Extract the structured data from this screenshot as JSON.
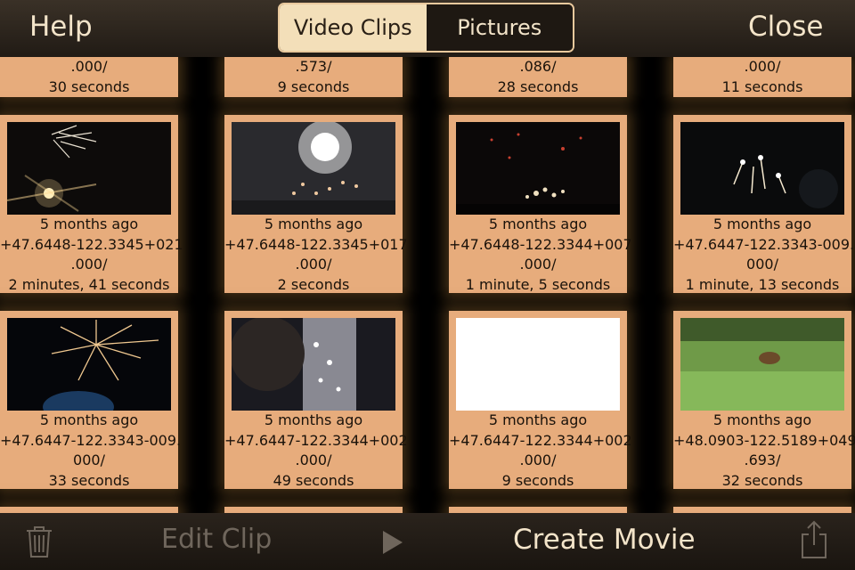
{
  "topbar": {
    "help_label": "Help",
    "close_label": "Close",
    "tabs": [
      "Video Clips",
      "Pictures"
    ],
    "selected_tab": "Video Clips"
  },
  "top_row": [
    {
      "line1": ".000/",
      "line2": "30 seconds"
    },
    {
      "line1": ".573/",
      "line2": "9 seconds"
    },
    {
      "line1": ".086/",
      "line2": "28 seconds"
    },
    {
      "line1": ".000/",
      "line2": "11 seconds"
    }
  ],
  "clips": [
    {
      "date": "5 months ago",
      "location": "+47.6448-122.3345+021",
      "location2": ".000/",
      "duration": "2 minutes, 41 seconds",
      "thumb": "fireworks-moon"
    },
    {
      "date": "5 months ago",
      "location": "+47.6448-122.3345+017",
      "location2": ".000/",
      "duration": "2 seconds",
      "thumb": "fireworks-bright"
    },
    {
      "date": "5 months ago",
      "location": "+47.6448-122.3344+007",
      "location2": ".000/",
      "duration": "1 minute, 5 seconds",
      "thumb": "fireworks-sparkle"
    },
    {
      "date": "5 months ago",
      "location": "+47.6447-122.3343-009.",
      "location2": "000/",
      "duration": "1 minute, 13 seconds",
      "thumb": "fireworks-small"
    },
    {
      "date": "5 months ago",
      "location": "+47.6447-122.3343-009.",
      "location2": "000/",
      "duration": "33 seconds",
      "thumb": "fireworks-burst"
    },
    {
      "date": "5 months ago",
      "location": "+47.6447-122.3344+002",
      "location2": ".000/",
      "duration": "49 seconds",
      "thumb": "fireworks-head"
    },
    {
      "date": "5 months ago",
      "location": "+47.6447-122.3344+002",
      "location2": ".000/",
      "duration": "9 seconds",
      "thumb": "blank-white"
    },
    {
      "date": "5 months ago",
      "location": "+48.0903-122.5189+049",
      "location2": ".693/",
      "duration": "32 seconds",
      "thumb": "grass-animal"
    }
  ],
  "bottombar": {
    "edit_label": "Edit Clip",
    "create_label": "Create Movie",
    "icons": [
      "trash-icon",
      "play-icon",
      "share-icon"
    ]
  }
}
